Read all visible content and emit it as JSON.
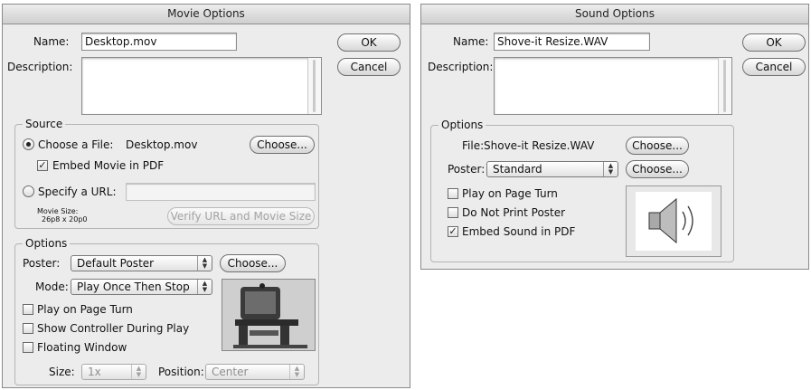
{
  "movie": {
    "title": "Movie Options",
    "name_label": "Name:",
    "name_value": "Desktop.mov",
    "description_label": "Description:",
    "ok_label": "OK",
    "cancel_label": "Cancel",
    "source": {
      "title": "Source",
      "choose_file_label": "Choose a File:",
      "file_name": "Desktop.mov",
      "choose_button": "Choose...",
      "embed_label": "Embed Movie in PDF",
      "embed_checked": true,
      "specify_url_label": "Specify a URL:",
      "url_value": "",
      "movie_size_label": "Movie Size:",
      "movie_size_value": "26p8 x 20p0",
      "verify_button": "Verify URL and Movie Size"
    },
    "options": {
      "title": "Options",
      "poster_label": "Poster:",
      "poster_value": "Default Poster",
      "choose_button": "Choose...",
      "mode_label": "Mode:",
      "mode_value": "Play Once Then Stop",
      "play_on_turn": "Play on Page Turn",
      "show_controller": "Show Controller During Play",
      "floating_window": "Floating Window",
      "size_label": "Size:",
      "size_value": "1x",
      "position_label": "Position:",
      "position_value": "Center",
      "poster_preview_icon": "computer-workstation-photo"
    }
  },
  "sound": {
    "title": "Sound Options",
    "name_label": "Name:",
    "name_value": "Shove-it Resize.WAV",
    "description_label": "Description:",
    "ok_label": "OK",
    "cancel_label": "Cancel",
    "options": {
      "title": "Options",
      "file_label": "File:",
      "file_name": "Shove-it Resize.WAV",
      "choose_button": "Choose...",
      "poster_label": "Poster:",
      "poster_value": "Standard",
      "poster_choose_button": "Choose...",
      "play_on_turn": "Play on Page Turn",
      "do_not_print": "Do Not Print Poster",
      "embed_sound": "Embed Sound in PDF",
      "embed_checked": true,
      "poster_preview_icon": "speaker-icon"
    }
  }
}
